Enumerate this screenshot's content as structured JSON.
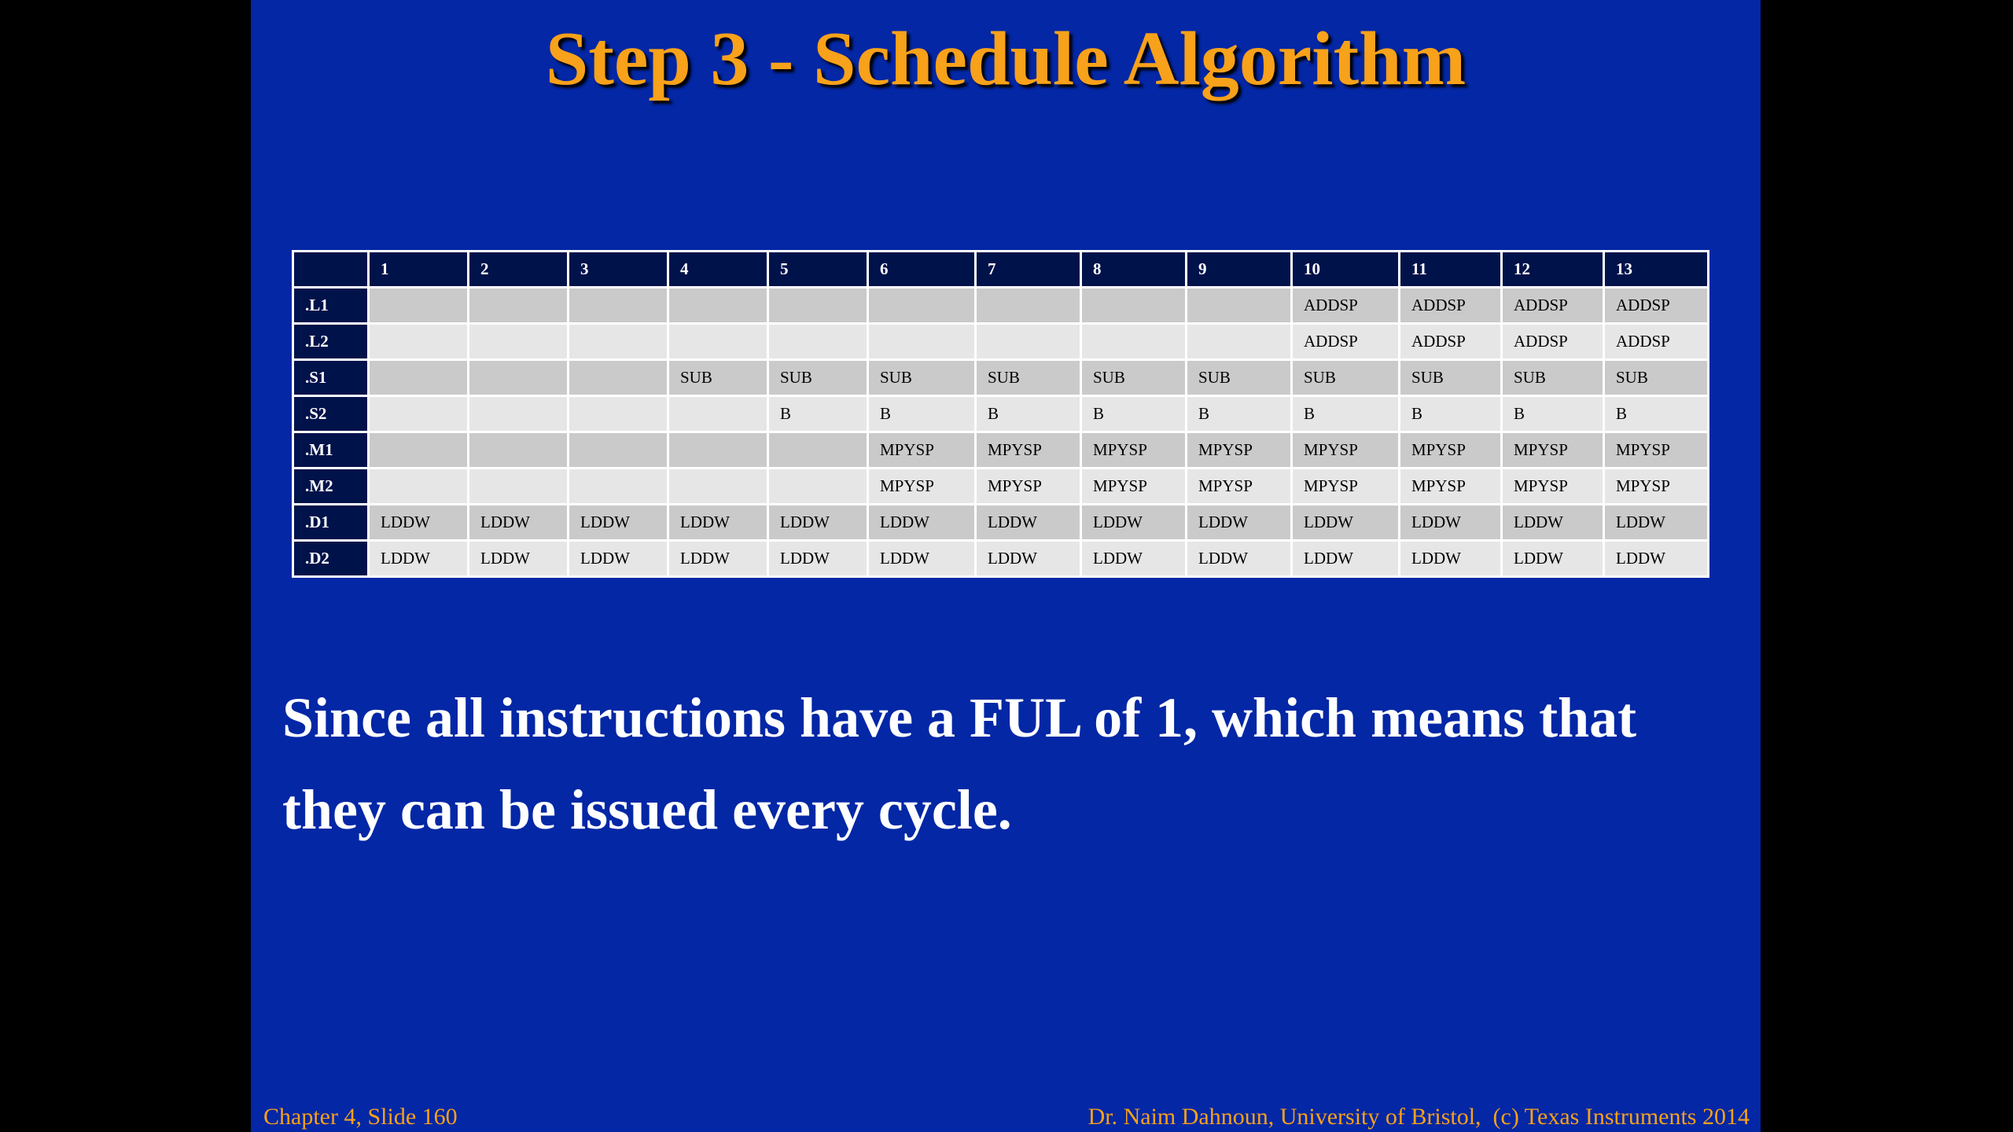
{
  "slide": {
    "title": "Step 3 - Schedule Algorithm",
    "body_text": "Since all instructions have a FUL of 1, which means that they can be issued every cycle.",
    "footer_left": "Chapter 4, Slide 160",
    "footer_right": "Dr. Naim Dahnoun, University of Bristol,  (c) Texas Instruments 2014",
    "colors": {
      "background": "#0327a5",
      "title": "#f8a11a",
      "header_cell": "#00124a",
      "row_odd": "#cacaca",
      "row_even": "#e6e6e6"
    }
  },
  "schedule_table": {
    "corner": "",
    "cycles": [
      "1",
      "2",
      "3",
      "4",
      "5",
      "6",
      "7",
      "8",
      "9",
      "10",
      "11",
      "12",
      "13"
    ],
    "rows": [
      {
        "unit": ".L1",
        "cells": [
          "",
          "",
          "",
          "",
          "",
          "",
          "",
          "",
          "",
          "ADDSP",
          "ADDSP",
          "ADDSP",
          "ADDSP"
        ]
      },
      {
        "unit": ".L2",
        "cells": [
          "",
          "",
          "",
          "",
          "",
          "",
          "",
          "",
          "",
          "ADDSP",
          "ADDSP",
          "ADDSP",
          "ADDSP"
        ]
      },
      {
        "unit": ".S1",
        "cells": [
          "",
          "",
          "",
          "SUB",
          "SUB",
          "SUB",
          "SUB",
          "SUB",
          "SUB",
          "SUB",
          "SUB",
          "SUB",
          "SUB"
        ]
      },
      {
        "unit": ".S2",
        "cells": [
          "",
          "",
          "",
          "",
          "B",
          "B",
          "B",
          "B",
          "B",
          "B",
          "B",
          "B",
          "B"
        ]
      },
      {
        "unit": ".M1",
        "cells": [
          "",
          "",
          "",
          "",
          "",
          "MPYSP",
          "MPYSP",
          "MPYSP",
          "MPYSP",
          "MPYSP",
          "MPYSP",
          "MPYSP",
          "MPYSP"
        ]
      },
      {
        "unit": ".M2",
        "cells": [
          "",
          "",
          "",
          "",
          "",
          "MPYSP",
          "MPYSP",
          "MPYSP",
          "MPYSP",
          "MPYSP",
          "MPYSP",
          "MPYSP",
          "MPYSP"
        ]
      },
      {
        "unit": ".D1",
        "cells": [
          "LDDW",
          "LDDW",
          "LDDW",
          "LDDW",
          "LDDW",
          "LDDW",
          "LDDW",
          "LDDW",
          "LDDW",
          "LDDW",
          "LDDW",
          "LDDW",
          "LDDW"
        ]
      },
      {
        "unit": ".D2",
        "cells": [
          "LDDW",
          "LDDW",
          "LDDW",
          "LDDW",
          "LDDW",
          "LDDW",
          "LDDW",
          "LDDW",
          "LDDW",
          "LDDW",
          "LDDW",
          "LDDW",
          "LDDW"
        ]
      }
    ]
  }
}
